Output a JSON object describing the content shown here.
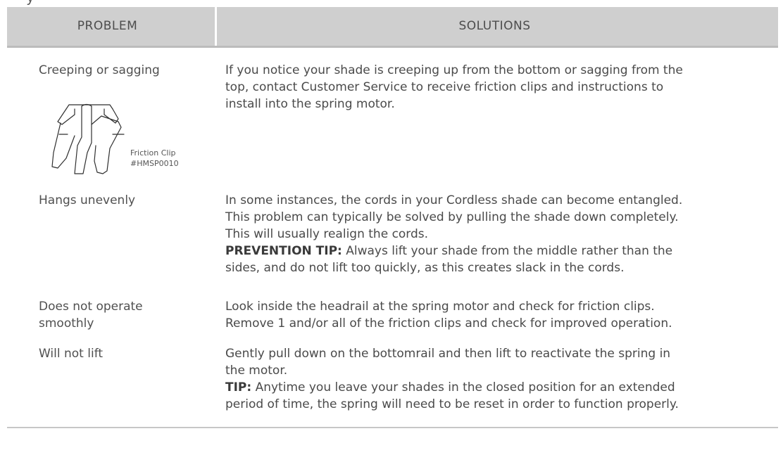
{
  "page": {
    "top_fragment": "y"
  },
  "table": {
    "headers": {
      "problem": "PROBLEM",
      "solutions": "SOLUTIONS"
    },
    "rows": [
      {
        "problem": "Creeping or sagging",
        "solution_lines": [
          "If you notice your shade is creeping up from the bottom or sagging from the",
          "top, contact Customer Service to receive friction clips and instructions to",
          "install into the spring motor."
        ],
        "illustration": {
          "icon": "friction-clip-icon",
          "caption_line1": "Friction Clip",
          "caption_line2": "#HMSP0010"
        }
      },
      {
        "problem": "Hangs unevenly",
        "solution_lines": [
          "In some instances, the cords in your Cordless shade can become entangled.",
          "This problem can typically be solved by pulling the shade down completely.",
          "This will usually realign the cords."
        ],
        "tip_label": "PREVENTION TIP:",
        "tip_text_line1": " Always lift your shade from the middle rather than the",
        "tip_text_line2": "sides, and do not lift too quickly, as this creates slack in the cords."
      },
      {
        "problem_lines": [
          "Does not operate",
          "smoothly"
        ],
        "solution_lines": [
          "Look inside the headrail at the spring motor and check for friction clips.",
          "Remove 1 and/or all of the friction clips and check for improved operation."
        ]
      },
      {
        "problem": "Will not lift",
        "solution_lines": [
          "Gently pull down on the bottomrail and then lift to reactivate the spring in",
          "the motor."
        ],
        "tip_label": "TIP:",
        "tip_text_line1": " Anytime you leave your shades in the closed position for an extended",
        "tip_text_line2": "period of time, the spring will need to be reset in order to function properly."
      }
    ]
  }
}
